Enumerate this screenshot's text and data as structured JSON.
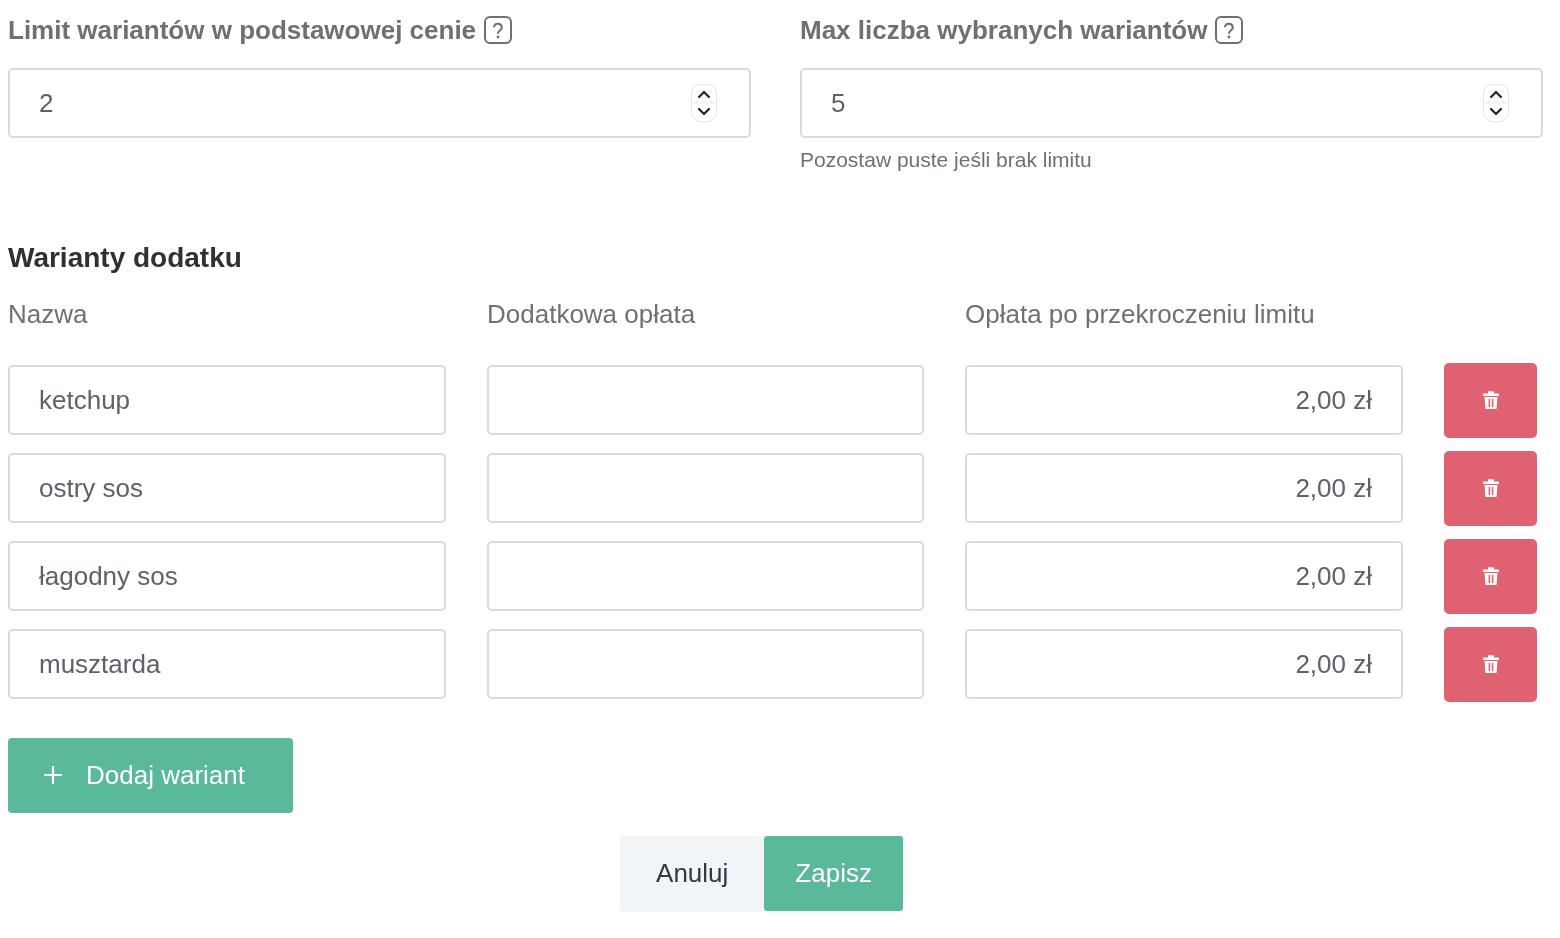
{
  "limit_fields": [
    {
      "label": "Limit wariantów w podstawowej cenie",
      "value": "2"
    },
    {
      "label": "Max liczba wybranych wariantów",
      "value": "5",
      "hint": "Pozostaw puste jeśli brak limitu"
    }
  ],
  "variants": {
    "title": "Warianty dodatku",
    "columns": [
      "Nazwa",
      "Dodatkowa opłata",
      "Opłata po przekroczeniu limitu"
    ],
    "rows": [
      {
        "name": "ketchup",
        "over_limit_fee": "2,00 zł"
      },
      {
        "name": "ostry sos",
        "over_limit_fee": "2,00 zł"
      },
      {
        "name": "łagodny sos",
        "over_limit_fee": "2,00 zł"
      },
      {
        "name": "musztarda",
        "over_limit_fee": "2,00 zł"
      }
    ],
    "add_button": "Dodaj wariant"
  },
  "actions": [
    {
      "kind": "secondary",
      "label": "Anuluj"
    },
    {
      "kind": "primary",
      "label": "Zapisz"
    }
  ]
}
